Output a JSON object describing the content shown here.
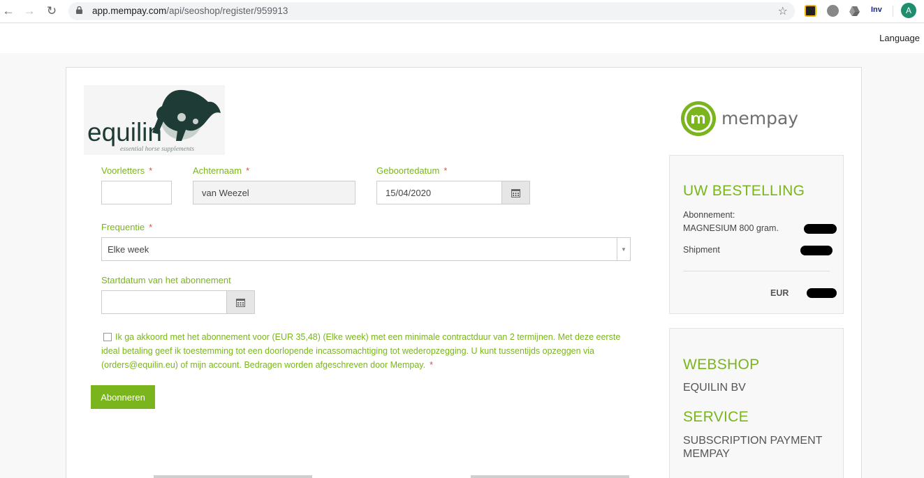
{
  "browser": {
    "url_host": "app.mempay.com",
    "url_path": "/api/seoshop/register/959913",
    "ext_label": "Inv",
    "profile_initial": "A"
  },
  "topbar": {
    "language": "Language"
  },
  "brand": {
    "shop_logo_text": "equilin",
    "shop_logo_tagline": "essential horse supplements",
    "payment_logo_text": "mempay",
    "accent_color": "#7ab51d"
  },
  "form": {
    "initials_label": "Voorletters",
    "initials_value": "",
    "lastname_label": "Achternaam",
    "lastname_value": "van Weezel",
    "birthdate_label": "Geboortedatum",
    "birthdate_value": "15/04/2020",
    "frequency_label": "Frequentie",
    "frequency_value": "Elke week",
    "startdate_label": "Startdatum van het abonnement",
    "startdate_value": "",
    "required_mark": "*",
    "terms_text": "Ik ga akkoord met het abonnement voor (EUR 35,48) (Elke week) met een minimale contractduur van 2 termijnen. Met deze eerste ideal betaling geef ik toestemming tot een doorlopende incassomachtiging tot wederopzegging. U kunt tussentijds opzeggen via (orders@equilin.eu) of mijn account. Bedragen worden afgeschreven door Mempay.",
    "submit_label": "Abonneren"
  },
  "order": {
    "title": "UW BESTELLING",
    "subscription_label": "Abonnement:",
    "product_name": "MAGNESIUM 800 gram.",
    "shipment_label": "Shipment",
    "currency": "EUR"
  },
  "shop": {
    "webshop_title": "WEBSHOP",
    "webshop_name": "EQUILIN BV",
    "service_title": "SERVICE",
    "service_name": "SUBSCRIPTION PAYMENT MEMPAY"
  }
}
